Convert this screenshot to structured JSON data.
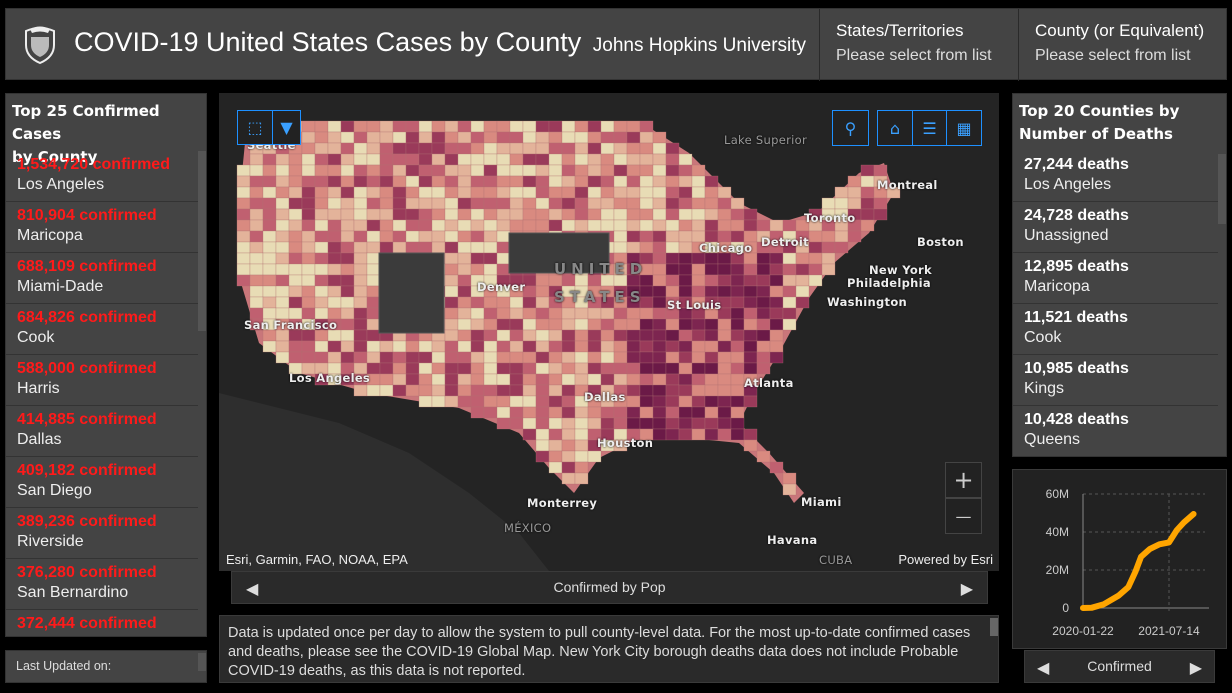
{
  "header": {
    "title": "COVID-19 United States Cases by County",
    "subtitle": "Johns Hopkins University",
    "states_label": "States/Territories",
    "states_placeholder": "Please select from list",
    "county_label": "County (or Equivalent)",
    "county_placeholder": "Please select from list"
  },
  "left_panel": {
    "title_line1": "Top 25 Confirmed Cases",
    "title_line2": "by County",
    "items": [
      {
        "value": "1,534,720 confirmed",
        "name": "Los Angeles"
      },
      {
        "value": "810,904 confirmed",
        "name": "Maricopa"
      },
      {
        "value": "688,109 confirmed",
        "name": "Miami-Dade"
      },
      {
        "value": "684,826 confirmed",
        "name": "Cook"
      },
      {
        "value": "588,000 confirmed",
        "name": "Harris"
      },
      {
        "value": "414,885 confirmed",
        "name": "Dallas"
      },
      {
        "value": "409,182 confirmed",
        "name": "San Diego"
      },
      {
        "value": "389,236 confirmed",
        "name": "Riverside"
      },
      {
        "value": "376,280 confirmed",
        "name": "San Bernardino"
      },
      {
        "value": "372,444 confirmed",
        "name": ""
      }
    ],
    "last_updated": "Last Updated on:"
  },
  "right_panel": {
    "title_line1": "Top 20 Counties by",
    "title_line2": "Number of Deaths",
    "items": [
      {
        "value": "27,244 deaths",
        "name": "Los Angeles"
      },
      {
        "value": "24,728 deaths",
        "name": "Unassigned"
      },
      {
        "value": "12,895 deaths",
        "name": "Maricopa"
      },
      {
        "value": "11,521 deaths",
        "name": "Cook"
      },
      {
        "value": "10,985 deaths",
        "name": "Kings"
      },
      {
        "value": "10,428 deaths",
        "name": "Queens"
      }
    ]
  },
  "map": {
    "attribution": "Esri, Garmin, FAO, NOAA, EPA",
    "powered": "Powered by Esri",
    "cities": [
      "Seattle",
      "Lake Superior",
      "Montreal",
      "Toronto",
      "Boston",
      "Chicago",
      "Detroit",
      "New York",
      "Philadelphia",
      "Washington",
      "UNITED",
      "STATES",
      "Denver",
      "St Louis",
      "San Francisco",
      "Los Angeles",
      "Atlanta",
      "Dallas",
      "Houston",
      "Monterrey",
      "MÉXICO",
      "Miami",
      "Havana",
      "CUBA"
    ],
    "zoom_in": "+",
    "zoom_out": "—",
    "icons": [
      "select-icon",
      "dropdown-icon",
      "search-icon",
      "home-icon",
      "legend-icon",
      "basemap-icon"
    ],
    "colors": {
      "low": "#e8dcb5",
      "mid": "#d98a80",
      "high": "#6b1a47",
      "bg": "#242424"
    }
  },
  "map_nav": {
    "label": "Confirmed by Pop"
  },
  "note": "Data is updated once per day to allow the system to pull county-level data. For the most up-to-date confirmed cases and deaths, please see the COVID-19 Global Map. New York City borough deaths data does not include Probable COVID-19 deaths, as this data is not reported.",
  "chart_nav": {
    "label": "Confirmed"
  },
  "chart_data": {
    "type": "line",
    "color": "#ffa500",
    "xlabel": "",
    "ylabel": "",
    "x_ticks": [
      "2020-01-22",
      "2021-07-14"
    ],
    "y_ticks": [
      "0",
      "20M",
      "40M",
      "60M"
    ],
    "ylim": [
      0,
      60000000
    ],
    "grid": true,
    "series": [
      {
        "x": [
          "2020-01-22",
          "2020-03-15",
          "2020-06-01",
          "2020-09-01",
          "2020-11-01",
          "2020-12-15",
          "2021-01-20",
          "2021-03-15",
          "2021-05-15",
          "2021-07-14",
          "2021-09-01",
          "2021-10-15",
          "2021-12-15"
        ],
        "y": [
          0,
          100000,
          2000000,
          6500000,
          11000000,
          19000000,
          27000000,
          31000000,
          33500000,
          34500000,
          41000000,
          45000000,
          49500000
        ]
      }
    ]
  }
}
